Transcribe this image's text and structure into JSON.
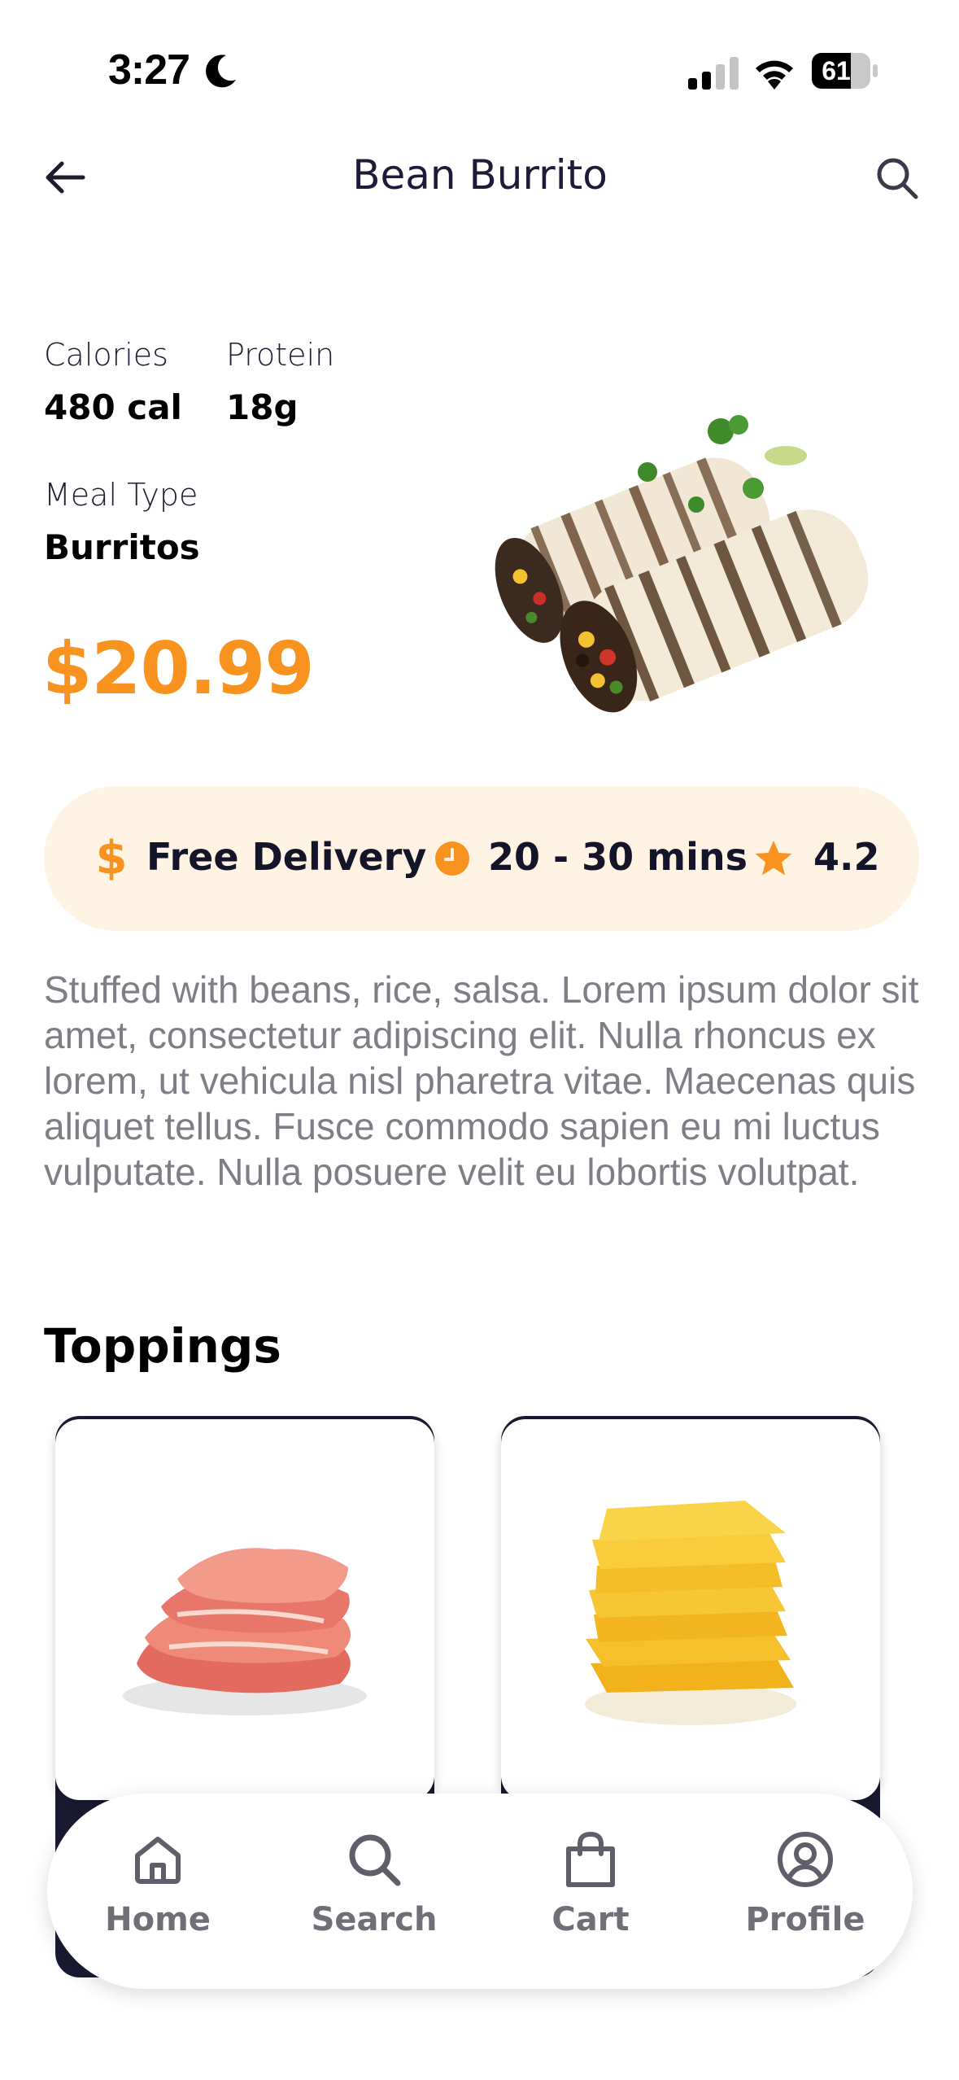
{
  "status_bar": {
    "time": "3:27",
    "battery": "61"
  },
  "header": {
    "title": "Bean Burrito"
  },
  "nutrition": {
    "calories_label": "Calories",
    "calories_value": "480 cal",
    "protein_label": "Protein",
    "protein_value": "18g",
    "meal_type_label": "Meal Type",
    "meal_type_value": "Burritos"
  },
  "price": "$20.99",
  "info": {
    "delivery_symbol": "$",
    "delivery": "Free Delivery",
    "time": "20 - 30 mins",
    "rating": "4.2"
  },
  "description": "Stuffed with beans, rice, salsa. Lorem ipsum dolor sit amet, consectetur adipiscing elit. Nulla rhoncus ex lorem, ut vehicula nisl pharetra vitae. Maecenas quis aliquet tellus. Fusce commodo sapien eu mi luctus vulputate. Nulla posuere velit eu lobortis volutpat.",
  "toppings": {
    "title": "Toppings",
    "items": [
      {
        "icon": "ham-slices"
      },
      {
        "icon": "cheese-slices"
      }
    ]
  },
  "nav": {
    "items": [
      {
        "label": "Home",
        "icon": "home-icon"
      },
      {
        "label": "Search",
        "icon": "search-icon"
      },
      {
        "label": "Cart",
        "icon": "bag-icon"
      },
      {
        "label": "Profile",
        "icon": "user-circle-icon"
      }
    ]
  },
  "colors": {
    "accent": "#f7931e",
    "pill_bg": "#fff3e3",
    "dark": "#1a1b33",
    "muted_text": "#7e7e86"
  }
}
